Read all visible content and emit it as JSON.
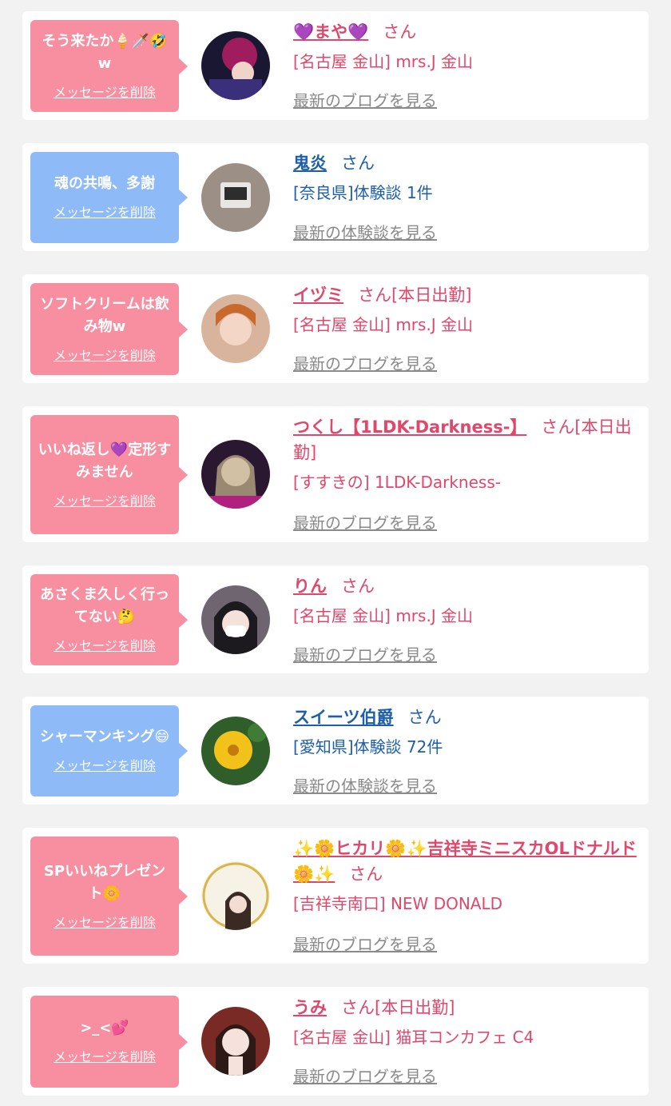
{
  "items": [
    {
      "type": "pink",
      "message": "そう来たか🍦🗡️🤣w",
      "delete_label": "メッセージを削除",
      "name": "💜まや💜",
      "honorific": "さん",
      "shop": "[名古屋 金山] mrs.J 金山",
      "link": "最新のブログを見る"
    },
    {
      "type": "blue",
      "message": "魂の共鳴、多謝",
      "delete_label": "メッセージを削除",
      "name": "鬼炎",
      "honorific": "さん",
      "shop": "[奈良県]体験談 1件",
      "link": "最新の体験談を見る"
    },
    {
      "type": "pink",
      "message": "ソフトクリームは飲み物w",
      "delete_label": "メッセージを削除",
      "name": "イヅミ",
      "honorific": "さん[本日出勤]",
      "shop": "[名古屋 金山] mrs.J 金山",
      "link": "最新のブログを見る"
    },
    {
      "type": "pink",
      "message": "いいね返し💜定形すみません",
      "delete_label": "メッセージを削除",
      "name": "つくし【1LDK-Darkness-】",
      "honorific": "さん[本日出勤]",
      "shop": "[すすきの] 1LDK-Darkness-",
      "link": "最新のブログを見る"
    },
    {
      "type": "pink",
      "message": "あさくま久しく行ってない🤔",
      "delete_label": "メッセージを削除",
      "name": "りん",
      "honorific": "さん",
      "shop": "[名古屋 金山] mrs.J 金山",
      "link": "最新のブログを見る"
    },
    {
      "type": "blue",
      "message": "シャーマンキング😄",
      "delete_label": "メッセージを削除",
      "name": "スイーツ伯爵",
      "honorific": "さん",
      "shop": "[愛知県]体験談 72件",
      "link": "最新の体験談を見る"
    },
    {
      "type": "pink",
      "message": "SPいいねプレゼント🌼",
      "delete_label": "メッセージを削除",
      "name": "✨🌼ヒカリ🌼✨吉祥寺ミニスカOLドナルド🌼✨",
      "honorific": "さん",
      "shop": "[吉祥寺南口] NEW DONALD",
      "link": "最新のブログを見る"
    },
    {
      "type": "pink",
      "message": ">_<💕",
      "delete_label": "メッセージを削除",
      "name": "うみ",
      "honorific": "さん[本日出勤]",
      "shop": "[名古屋 金山] 猫耳コンカフェ C4",
      "link": "最新のブログを見る"
    }
  ],
  "avatar_icons": [
    "avatar-photo-icon"
  ],
  "colors": {
    "pink_bubble": "#f88fa0",
    "blue_bubble": "#8ebaf7",
    "pink_text": "#e0476b",
    "blue_text": "#1d5fa8",
    "link_gray": "#8a8a8a",
    "page_bg": "#f2f2f2"
  }
}
